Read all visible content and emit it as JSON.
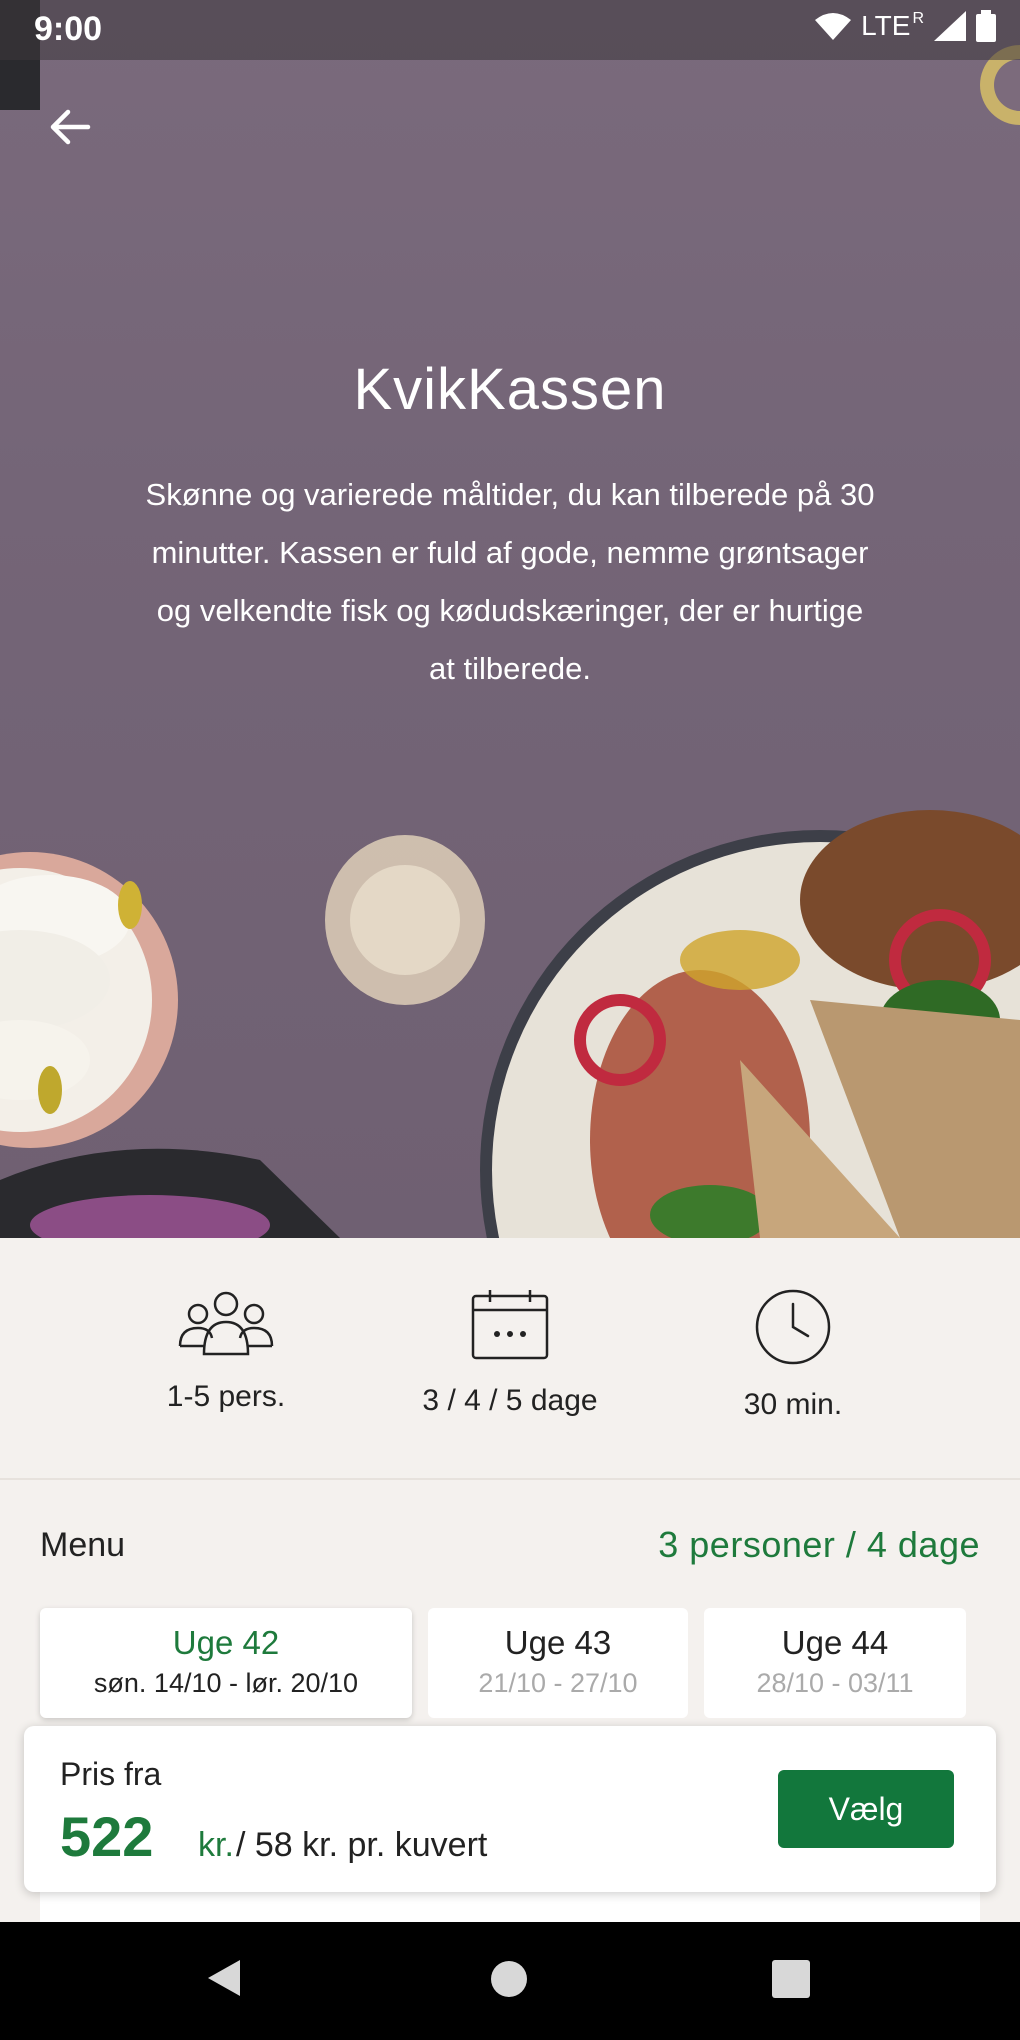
{
  "status_bar": {
    "time": "9:00",
    "network": "LTE",
    "roaming": "R"
  },
  "hero": {
    "title": "KvikKassen",
    "description": "Skønne og varierede måltider, du kan tilberede på 30 minutter. Kassen er fuld af gode, nemme grøntsager og velkendte fisk og kødudskæringer, der er hurtige at tilberede."
  },
  "features": [
    {
      "icon": "people-icon",
      "label": "1-5 pers."
    },
    {
      "icon": "calendar-icon",
      "label": "3 / 4 / 5 dage"
    },
    {
      "icon": "clock-icon",
      "label": "30 min."
    }
  ],
  "menu": {
    "heading": "Menu",
    "selection": "3 personer / 4 dage",
    "weeks": [
      {
        "label": "Uge 42",
        "dates": "søn. 14/10 - lør. 20/10",
        "active": true
      },
      {
        "label": "Uge 43",
        "dates": "21/10 - 27/10",
        "active": false
      },
      {
        "label": "Uge 44",
        "dates": "28/10 - 03/11",
        "active": false
      }
    ]
  },
  "price": {
    "label": "Pris fra",
    "amount": "522",
    "currency": "kr.",
    "per_cover": "/ 58 kr. pr. kuvert",
    "button": "Vælg"
  },
  "colors": {
    "accent": "#1e7a3c",
    "button": "#12773c",
    "hero_bg": "#746577"
  }
}
